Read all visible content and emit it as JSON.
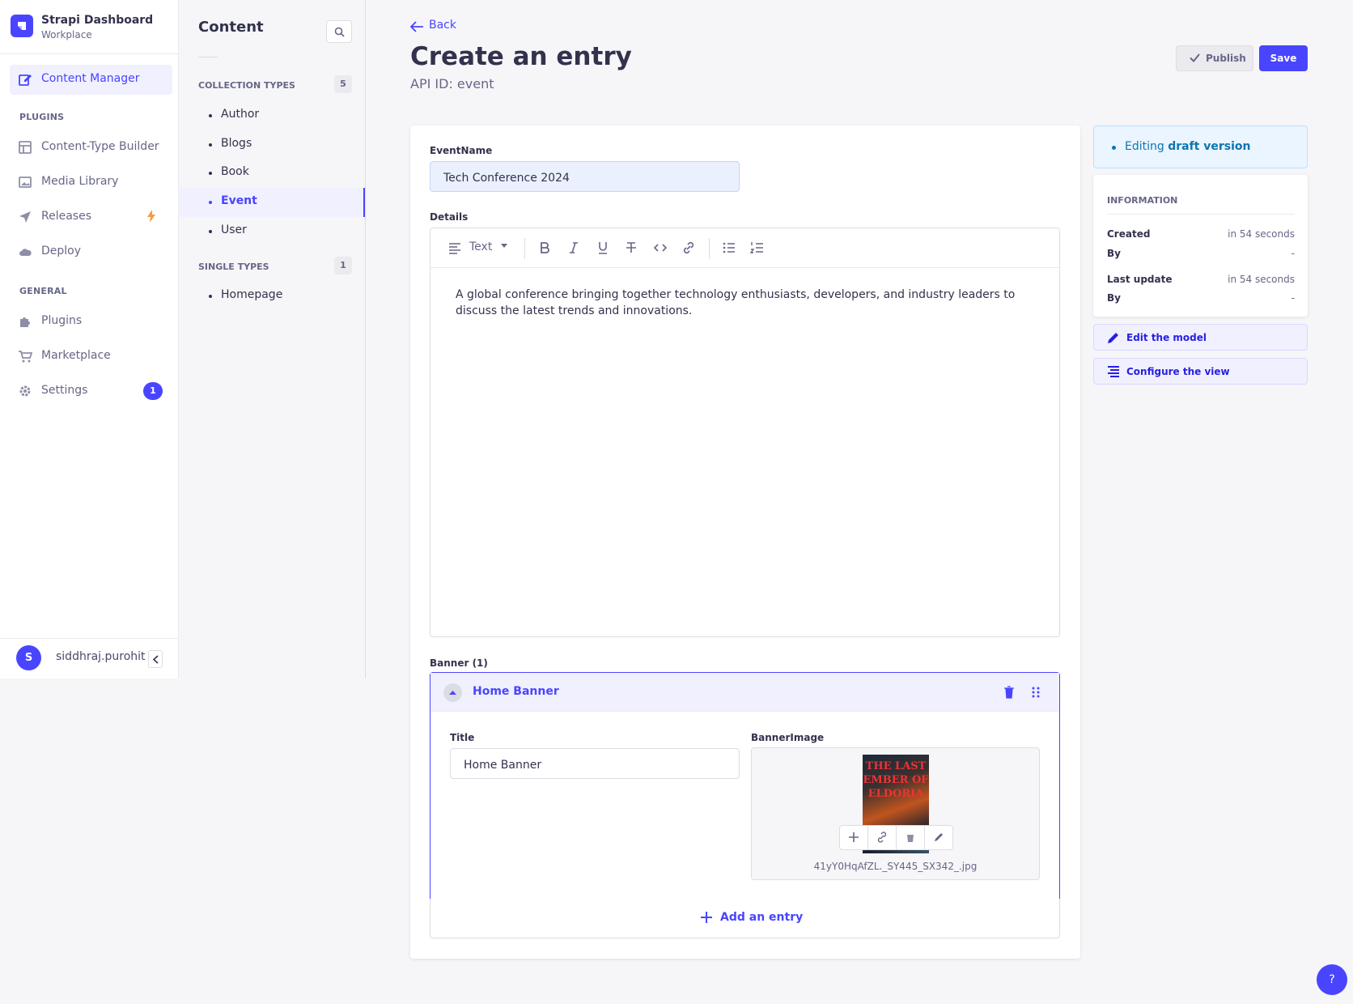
{
  "brand": {
    "title": "Strapi Dashboard",
    "subtitle": "Workplace"
  },
  "mainnav": {
    "content_manager": "Content Manager",
    "plugins_section": "PLUGINS",
    "content_type_builder": "Content-Type Builder",
    "media_library": "Media Library",
    "releases": "Releases",
    "deploy": "Deploy",
    "general_section": "GENERAL",
    "plugins": "Plugins",
    "marketplace": "Marketplace",
    "settings": "Settings",
    "settings_badge": "1"
  },
  "user": {
    "initial": "S",
    "name": "siddhraj.purohit"
  },
  "subnav": {
    "title": "Content",
    "collection_section": "COLLECTION TYPES",
    "collection_count": "5",
    "collection_items": [
      "Author",
      "Blogs",
      "Book",
      "Event",
      "User"
    ],
    "single_section": "SINGLE TYPES",
    "single_count": "1",
    "single_items": [
      "Homepage"
    ]
  },
  "header": {
    "back": "Back",
    "title": "Create an entry",
    "subtitle": "API ID: event",
    "publish": "Publish",
    "save": "Save"
  },
  "form": {
    "eventname_label": "EventName",
    "eventname_value": "Tech Conference 2024",
    "details_label": "Details",
    "toolbar_style": "Text",
    "details_text": "A global conference bringing together technology enthusiasts, developers, and industry leaders to discuss the latest trends and innovations.",
    "banner_label": "Banner (1)",
    "banner_name": "Home Banner",
    "title_label": "Title",
    "title_value": "Home Banner",
    "bannerimage_label": "BannerImage",
    "book_text": "THE LAST EMBER OF ELDORIA",
    "file_name": "41yY0HqAfZL._SY445_SX342_.jpg",
    "add_entry": "Add an entry"
  },
  "side": {
    "editing": "Editing",
    "draft_version": "draft version",
    "info_title": "INFORMATION",
    "created_label": "Created",
    "created_value": "in 54 seconds",
    "by_label": "By",
    "by_value": "-",
    "updated_label": "Last update",
    "updated_value": "in 54 seconds",
    "by2_label": "By",
    "by2_value": "-",
    "edit_model": "Edit the model",
    "configure_view": "Configure the view"
  },
  "help": "?",
  "colors": {
    "primary": "#4945ff",
    "draft_bg": "#eaf5ff",
    "draft_text": "#0c75af",
    "warning": "#f29d41"
  }
}
